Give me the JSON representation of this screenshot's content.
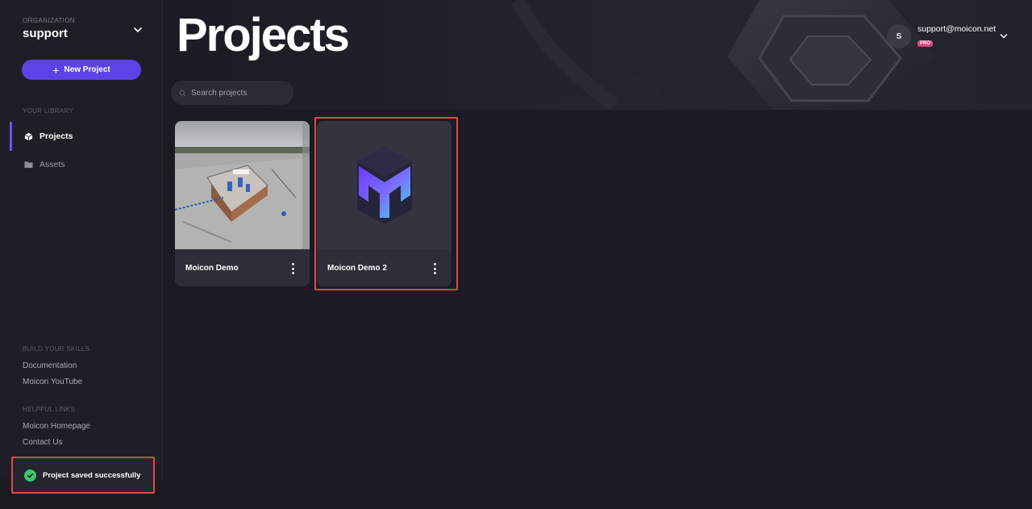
{
  "sidebar": {
    "org_label": "ORGANIZATION",
    "org_name": "support",
    "new_project_label": "New Project",
    "library_label": "YOUR LIBRARY",
    "nav": [
      {
        "label": "Projects",
        "icon": "cube-icon",
        "active": true
      },
      {
        "label": "Assets",
        "icon": "folder-icon",
        "active": false
      }
    ],
    "skills_label": "BUILD YOUR SKILLS",
    "skills_links": [
      "Documentation",
      "Moicon YouTube"
    ],
    "helpful_label": "HELPFUL LINKS",
    "helpful_links": [
      "Moicon Homepage",
      "Contact Us"
    ]
  },
  "header": {
    "title": "Projects",
    "search_placeholder": "Search projects",
    "user_initial": "S",
    "user_email": "support@moicon.net",
    "plan_badge": "PRO"
  },
  "projects": [
    {
      "title": "Moicon Demo",
      "thumbnail": "scene-screenshot"
    },
    {
      "title": "Moicon Demo 2",
      "thumbnail": "moicon-logo"
    }
  ],
  "toast": {
    "message": "Project saved successfully",
    "icon": "check-circle-icon"
  },
  "colors": {
    "accent": "#5b44e6",
    "highlight": "#e24848",
    "success": "#3fc56a",
    "pro": "#d9467e"
  }
}
